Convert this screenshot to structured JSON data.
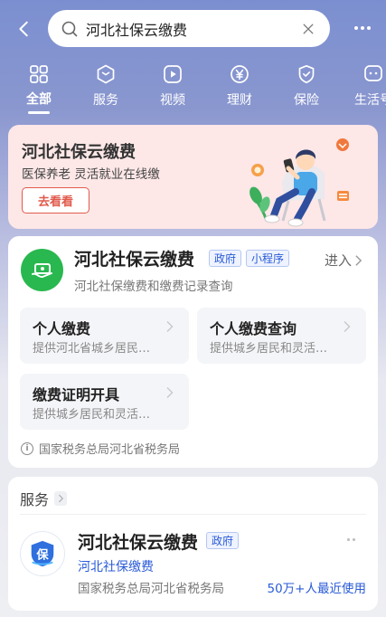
{
  "header": {
    "search_value": "河北社保云缴费"
  },
  "tabs": [
    {
      "label": "全部",
      "icon": "grid-icon",
      "active": true
    },
    {
      "label": "服务",
      "icon": "cube-icon",
      "active": false
    },
    {
      "label": "视频",
      "icon": "play-icon",
      "active": false
    },
    {
      "label": "理财",
      "icon": "yen-icon",
      "active": false
    },
    {
      "label": "保险",
      "icon": "shield-icon",
      "active": false
    },
    {
      "label": "生活号",
      "icon": "chat-icon",
      "active": false
    }
  ],
  "promo": {
    "title": "河北社保云缴费",
    "subtitle": "医保养老 灵活就业在线缴",
    "button": "去看看"
  },
  "result": {
    "title": "河北社保云缴费",
    "badges": [
      "政府",
      "小程序"
    ],
    "enter": "进入",
    "description": "河北社保缴费和缴费记录查询",
    "services": [
      {
        "title": "个人缴费",
        "desc": "提供河北省城乡居民…"
      },
      {
        "title": "个人缴费查询",
        "desc": "提供城乡居民和灵活…"
      },
      {
        "title": "缴费证明开具",
        "desc": "提供城乡居民和灵活…"
      }
    ],
    "provider": "国家税务总局河北省税务局"
  },
  "service_section": {
    "title": "服务",
    "item": {
      "name": "河北社保云缴费",
      "badge": "政府",
      "link": "河北社保缴费",
      "provider": "国家税务总局河北省税务局",
      "usage": "50万+人最近使用",
      "logo_char": "保"
    }
  },
  "colors": {
    "accent_blue": "#2a5bd7",
    "promo_red": "#e15a4c",
    "app_green": "#29b84f"
  }
}
